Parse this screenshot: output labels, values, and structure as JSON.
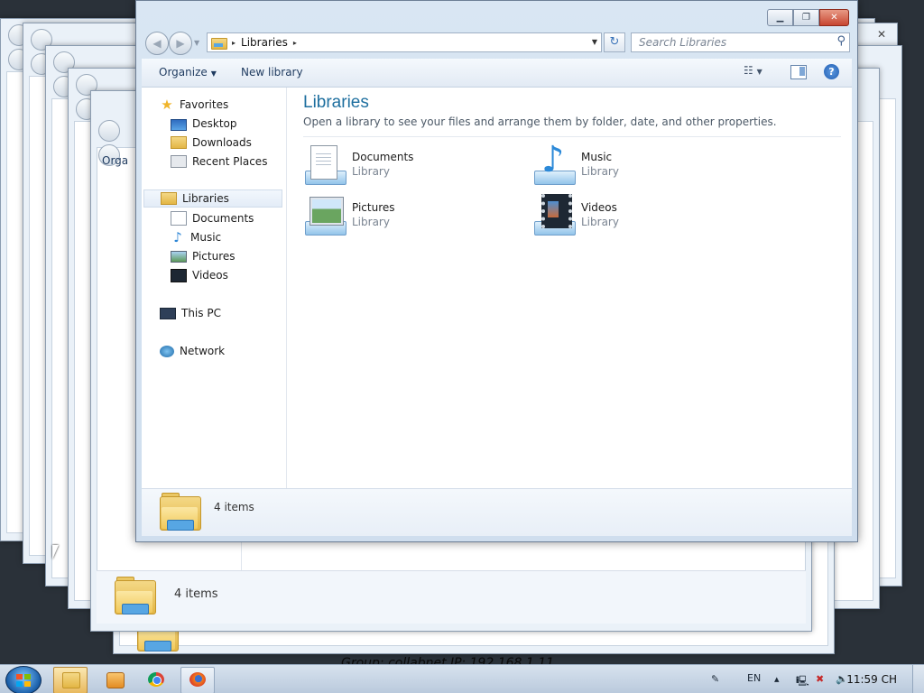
{
  "desktop": {
    "background_text": "Group: collabnet   IP: 192.168.1.11"
  },
  "ghost_window": {
    "organize_partial": "Orga",
    "status_count": "4 items"
  },
  "window": {
    "caption": {
      "minimize_icon": "minimize-icon",
      "maximize_icon": "maximize-icon",
      "close_icon": "close-icon"
    },
    "address": {
      "location": "Libraries",
      "separator": "▸"
    },
    "search": {
      "placeholder": "Search Libraries"
    },
    "toolbar": {
      "organize_label": "Organize",
      "new_library_label": "New library"
    },
    "sidebar": {
      "favorites": {
        "label": "Favorites",
        "items": [
          {
            "label": "Desktop"
          },
          {
            "label": "Downloads"
          },
          {
            "label": "Recent Places"
          }
        ]
      },
      "libraries": {
        "label": "Libraries",
        "items": [
          {
            "label": "Documents"
          },
          {
            "label": "Music"
          },
          {
            "label": "Pictures"
          },
          {
            "label": "Videos"
          }
        ]
      },
      "this_pc": {
        "label": "This PC"
      },
      "network": {
        "label": "Network"
      }
    },
    "main": {
      "title": "Libraries",
      "subtitle": "Open a library to see your files and arrange them by folder, date, and other properties.",
      "libraries": [
        {
          "name": "Documents",
          "type": "Library"
        },
        {
          "name": "Music",
          "type": "Library"
        },
        {
          "name": "Pictures",
          "type": "Library"
        },
        {
          "name": "Videos",
          "type": "Library"
        }
      ]
    },
    "status": {
      "count": "4 items"
    }
  },
  "taskbar": {
    "language": "EN",
    "clock": "11:59 CH"
  }
}
